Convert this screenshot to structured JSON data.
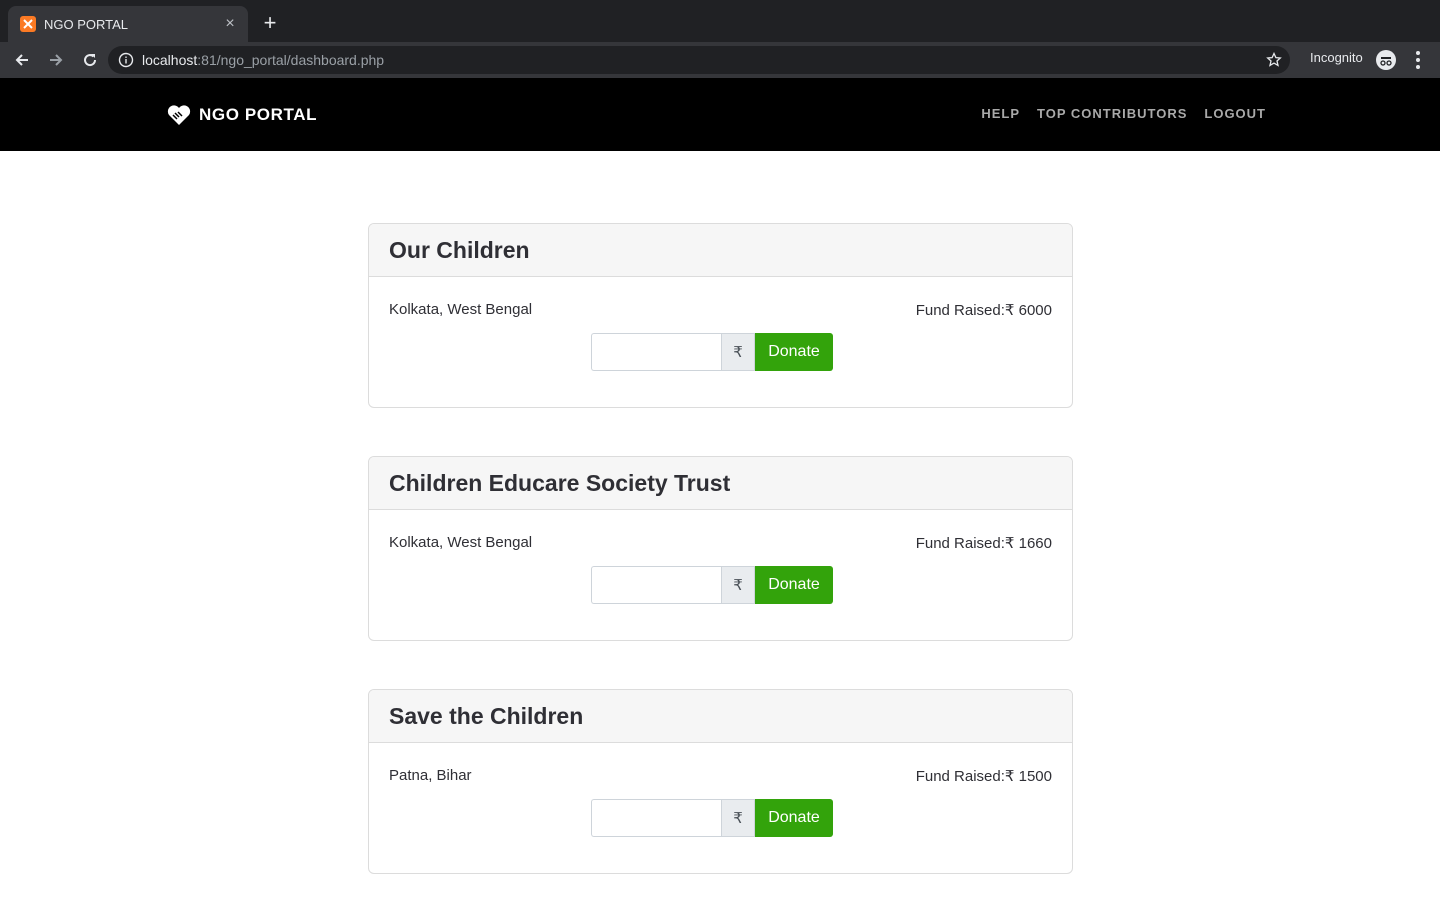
{
  "browser": {
    "tab_title": "NGO PORTAL",
    "url_host": "localhost",
    "url_rest": ":81/ngo_portal/dashboard.php",
    "incognito_label": "Incognito"
  },
  "site": {
    "brand": "NGO PORTAL",
    "nav": [
      "HELP",
      "TOP CONTRIBUTORS",
      "LOGOUT"
    ]
  },
  "currency_symbol": "₹",
  "donate_label": "Donate",
  "fund_prefix": "Fund Raised:₹ ",
  "ngos": [
    {
      "name": "Our Children",
      "location": "Kolkata, West Bengal",
      "fund": "6000"
    },
    {
      "name": "Children Educare Society Trust",
      "location": "Kolkata, West Bengal",
      "fund": "1660"
    },
    {
      "name": "Save the Children",
      "location": "Patna, Bihar",
      "fund": "1500"
    }
  ],
  "colors": {
    "navbar": "#000000",
    "donate_button": "#33a30b"
  }
}
